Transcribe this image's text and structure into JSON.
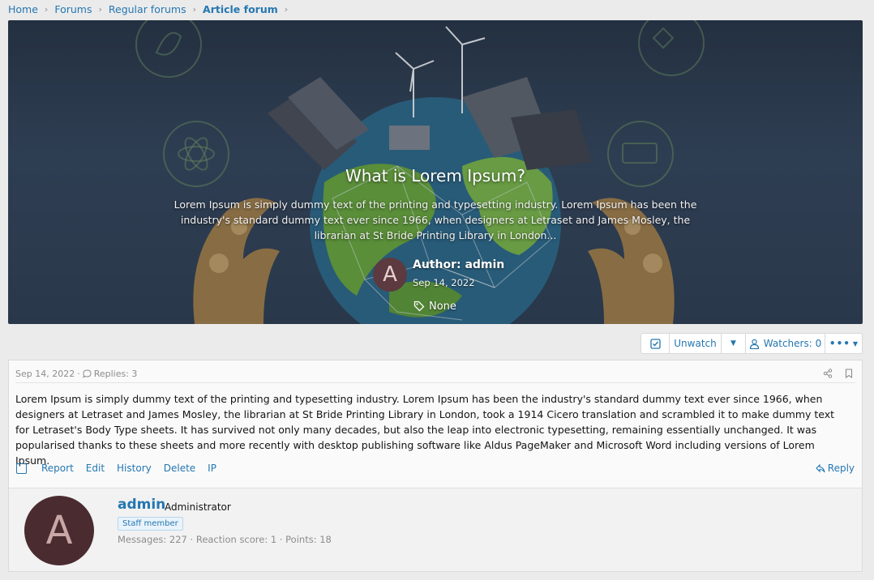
{
  "breadcrumb": {
    "items": [
      "Home",
      "Forums",
      "Regular forums"
    ],
    "current": "Article forum"
  },
  "hero": {
    "title": "What is Lorem Ipsum?",
    "description": "Lorem Ipsum is simply dummy text of the printing and typesetting industry. Lorem Ipsum has been the industry's standard dummy text ever since 1966, when designers at Letraset and James Mosley, the librarian at St Bride Printing Library in London...",
    "author_initial": "A",
    "author_label": "Author: admin",
    "date": "Sep 14, 2022",
    "tags": "None"
  },
  "watch_bar": {
    "unwatch": "Unwatch",
    "watchers": "Watchers: 0"
  },
  "post": {
    "date": "Sep 14, 2022",
    "separator": "·",
    "replies": "Replies: 3",
    "body": "Lorem Ipsum is simply dummy text of the printing and typesetting industry. Lorem Ipsum has been the industry's standard dummy text ever since 1966, when designers at Letraset and James Mosley, the librarian at St Bride Printing Library in London, took a 1914 Cicero translation and scrambled it to make dummy text for Letraset's Body Type sheets. It has survived not only many decades, but also the leap into electronic typesetting, remaining essentially unchanged. It was popularised thanks to these sheets and more recently with desktop publishing software like Aldus PageMaker and Microsoft Word including versions of Lorem Ipsum.",
    "actions": {
      "report": "Report",
      "edit": "Edit",
      "history": "History",
      "delete": "Delete",
      "ip": "IP",
      "reply": "Reply"
    }
  },
  "user": {
    "initial": "A",
    "name": "admin",
    "title": "Administrator",
    "badge": "Staff member",
    "stats": "Messages: 227 · Reaction score: 1 · Points: 18"
  },
  "colors": {
    "link": "#2577b1",
    "avatar_bg": "#4a2c30"
  }
}
